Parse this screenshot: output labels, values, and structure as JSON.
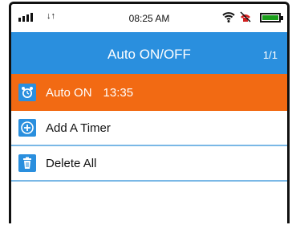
{
  "status_bar": {
    "data_indicator": "↓↑",
    "time": "08:25 AM"
  },
  "header": {
    "title": "Auto ON/OFF",
    "page_indicator": "1/1"
  },
  "list": {
    "items": [
      {
        "icon": "alarm-clock-icon",
        "label": "Auto ON",
        "time": "13:35"
      },
      {
        "icon": "plus-circle-icon",
        "label": "Add A Timer"
      },
      {
        "icon": "trash-icon",
        "label": "Delete All"
      }
    ]
  },
  "colors": {
    "accent": "#2a8fde",
    "highlight": "#f26a13"
  }
}
